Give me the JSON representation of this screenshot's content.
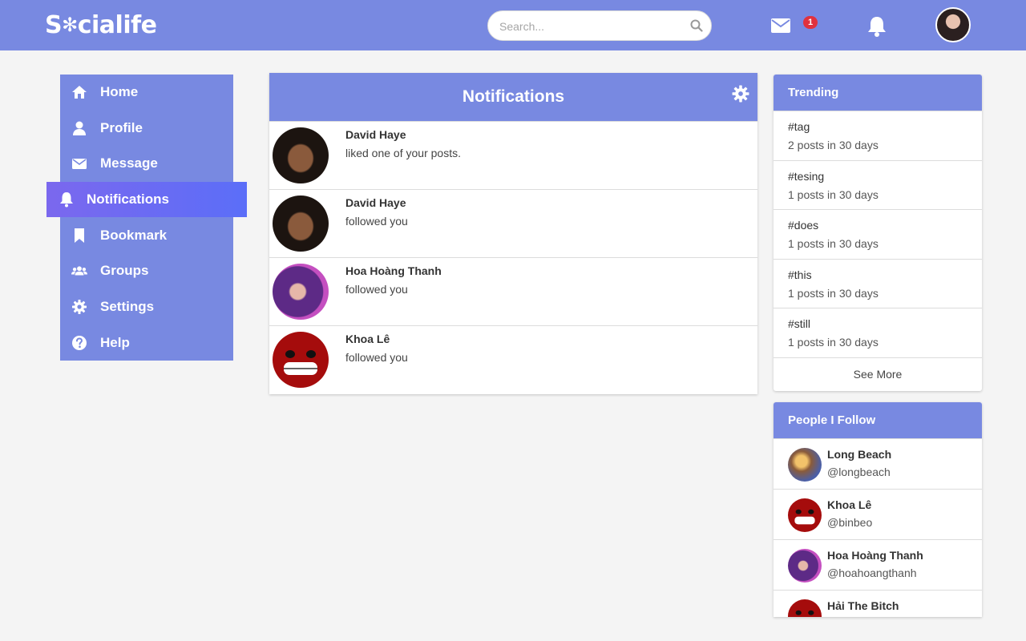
{
  "header": {
    "logo_left": "S",
    "logo_right": "cialife",
    "search_placeholder": "Search...",
    "mail_badge": "1"
  },
  "sidebar": {
    "items": [
      {
        "label": "Home",
        "icon": "home-icon"
      },
      {
        "label": "Profile",
        "icon": "user-icon"
      },
      {
        "label": "Message",
        "icon": "envelope-icon"
      },
      {
        "label": "Notifications",
        "icon": "bell-icon",
        "active": true
      },
      {
        "label": "Bookmark",
        "icon": "bookmark-icon"
      },
      {
        "label": "Groups",
        "icon": "users-icon"
      },
      {
        "label": "Settings",
        "icon": "gear-icon"
      },
      {
        "label": "Help",
        "icon": "question-icon"
      }
    ]
  },
  "notifications": {
    "title": "Notifications",
    "items": [
      {
        "name": "David Haye",
        "action": "liked one of your posts."
      },
      {
        "name": "David Haye",
        "action": "followed you"
      },
      {
        "name": "Hoa Hoàng Thanh",
        "action": "followed you"
      },
      {
        "name": "Khoa Lê",
        "action": "followed you"
      }
    ]
  },
  "trending": {
    "title": "Trending",
    "items": [
      {
        "tag": "#tag",
        "count": "2 posts in 30 days"
      },
      {
        "tag": "#tesing",
        "count": "1 posts in 30 days"
      },
      {
        "tag": "#does",
        "count": "1 posts in 30 days"
      },
      {
        "tag": "#this",
        "count": "1 posts in 30 days"
      },
      {
        "tag": "#still",
        "count": "1 posts in 30 days"
      }
    ],
    "see_more": "See More"
  },
  "following": {
    "title": "People I Follow",
    "items": [
      {
        "name": "Long Beach",
        "handle": "@longbeach"
      },
      {
        "name": "Khoa Lê",
        "handle": "@binbeo"
      },
      {
        "name": "Hoa Hoàng Thanh",
        "handle": "@hoahoangthanh"
      },
      {
        "name": "Hải The Bitch",
        "handle": ""
      }
    ]
  },
  "colors": {
    "accent": "#7889e1",
    "active_gradient_start": "#7b68ee",
    "active_gradient_end": "#5b6ef8",
    "badge": "#e0323e",
    "background": "#f4f4f4"
  }
}
